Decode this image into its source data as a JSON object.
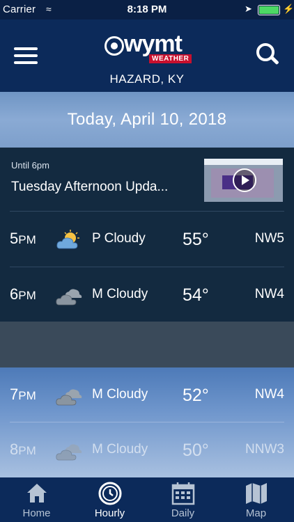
{
  "status_bar": {
    "carrier": "Carrier",
    "time": "8:18 PM"
  },
  "header": {
    "logo_text": "wymt",
    "logo_badge": "WEATHER",
    "location": "HAZARD, KY"
  },
  "date_banner": "Today, April 10, 2018",
  "video": {
    "until": "Until 6pm",
    "title": "Tuesday Afternoon Upda..."
  },
  "hourly": [
    {
      "hour": "5",
      "ampm": "PM",
      "icon": "partly-cloudy-icon",
      "condition": "P Cloudy",
      "temp": "55°",
      "wind": "NW5"
    },
    {
      "hour": "6",
      "ampm": "PM",
      "icon": "mostly-cloudy-icon",
      "condition": "M Cloudy",
      "temp": "54°",
      "wind": "NW4"
    },
    {
      "hour": "7",
      "ampm": "PM",
      "icon": "mostly-cloudy-icon",
      "condition": "M Cloudy",
      "temp": "52°",
      "wind": "NW4"
    },
    {
      "hour": "8",
      "ampm": "PM",
      "icon": "mostly-cloudy-icon",
      "condition": "M Cloudy",
      "temp": "50°",
      "wind": "NNW3"
    }
  ],
  "tabs": [
    {
      "label": "Home",
      "icon": "home-icon",
      "active": false
    },
    {
      "label": "Hourly",
      "icon": "clock-icon",
      "active": true
    },
    {
      "label": "Daily",
      "icon": "calendar-icon",
      "active": false
    },
    {
      "label": "Map",
      "icon": "map-icon",
      "active": false
    }
  ],
  "colors": {
    "header": "#0c2a5a",
    "panel": "#132a40",
    "accent_red": "#c8102e",
    "battery": "#4cd964"
  }
}
